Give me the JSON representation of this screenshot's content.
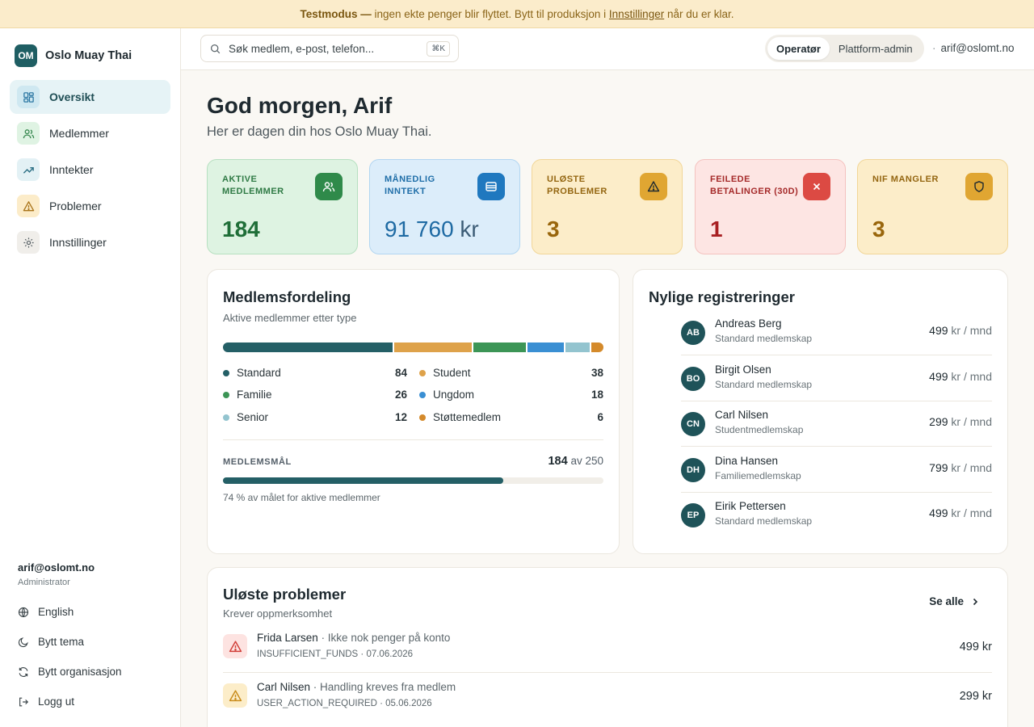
{
  "banner": {
    "strong": "Testmodus —",
    "text": "ingen ekte penger blir flyttet. Bytt til produksjon i",
    "link": "Innstillinger",
    "tail": "når du er klar."
  },
  "brand": {
    "initials": "OM",
    "name": "Oslo Muay Thai"
  },
  "nav": [
    {
      "label": "Oversikt",
      "icon": "dashboard-icon",
      "active": true
    },
    {
      "label": "Medlemmer",
      "icon": "users-icon"
    },
    {
      "label": "Inntekter",
      "icon": "trending-up-icon"
    },
    {
      "label": "Problemer",
      "icon": "warning-icon"
    },
    {
      "label": "Innstillinger",
      "icon": "gear-icon"
    }
  ],
  "sidebar_user": {
    "email": "arif@oslomt.no",
    "role": "Administrator"
  },
  "sidebar_links": [
    {
      "label": "English",
      "icon": "globe-icon"
    },
    {
      "label": "Bytt tema",
      "icon": "moon-icon"
    },
    {
      "label": "Bytt organisasjon",
      "icon": "refresh-icon"
    },
    {
      "label": "Logg ut",
      "icon": "logout-icon"
    }
  ],
  "topbar": {
    "search_placeholder": "Søk medlem, e-post, telefon...",
    "shortcut": "⌘K",
    "modes": [
      "Operatør",
      "Plattform-admin"
    ],
    "active_mode": "Operatør",
    "user": "arif@oslomt.no"
  },
  "greeting": {
    "title": "God morgen, Arif",
    "subtitle": "Her er dagen din hos Oslo Muay Thai."
  },
  "stats": [
    {
      "label": "Aktive medlemmer",
      "value": "184",
      "unit": "",
      "icon": "users-icon"
    },
    {
      "label": "Månedlig inntekt",
      "value": "91 760",
      "unit": "kr",
      "icon": "card-icon"
    },
    {
      "label": "Uløste problemer",
      "value": "3",
      "unit": "",
      "icon": "warning-icon"
    },
    {
      "label": "Feilede betalinger (30d)",
      "value": "1",
      "unit": "",
      "icon": "close-icon"
    },
    {
      "label": "NIF mangler",
      "value": "3",
      "unit": "",
      "icon": "shield-icon"
    }
  ],
  "distribution": {
    "title": "Medlemsfordeling",
    "subtitle": "Aktive medlemmer etter type",
    "segments": [
      {
        "name": "Standard",
        "count": 84,
        "color": "#245f66"
      },
      {
        "name": "Student",
        "count": 38,
        "color": "#dea24a"
      },
      {
        "name": "Familie",
        "count": 26,
        "color": "#3c9556"
      },
      {
        "name": "Ungdom",
        "count": 18,
        "color": "#3a8fd3"
      },
      {
        "name": "Senior",
        "count": 12,
        "color": "#93c4cf"
      },
      {
        "name": "Støttemedlem",
        "count": 6,
        "color": "#d48a2b"
      }
    ],
    "goal_label": "Medlemsmål",
    "goal_current": "184",
    "goal_target_text": "av 250",
    "goal_fraction": 0.736,
    "goal_note": "74 % av målet for aktive medlemmer"
  },
  "registrations": {
    "title": "Nylige registreringer",
    "rows": [
      {
        "initials": "AB",
        "name": "Andreas Berg",
        "plan": "Standard medlemskap",
        "price": "499",
        "unit": "kr / mnd"
      },
      {
        "initials": "BO",
        "name": "Birgit Olsen",
        "plan": "Standard medlemskap",
        "price": "499",
        "unit": "kr / mnd"
      },
      {
        "initials": "CN",
        "name": "Carl Nilsen",
        "plan": "Studentmedlemskap",
        "price": "299",
        "unit": "kr / mnd"
      },
      {
        "initials": "DH",
        "name": "Dina Hansen",
        "plan": "Familiemedlemskap",
        "price": "799",
        "unit": "kr / mnd"
      },
      {
        "initials": "EP",
        "name": "Eirik Pettersen",
        "plan": "Standard medlemskap",
        "price": "499",
        "unit": "kr / mnd"
      }
    ]
  },
  "problems": {
    "title": "Uløste problemer",
    "subtitle": "Krever oppmerksomhet",
    "see_all": "Se alle",
    "rows": [
      {
        "name": "Frida Larsen",
        "issue": "· Ikke nok penger på konto",
        "code": "INSUFFICIENT_FUNDS · 07.06.2026",
        "amount": "499 kr",
        "severity": "error"
      },
      {
        "name": "Carl Nilsen",
        "issue": "· Handling kreves fra medlem",
        "code": "USER_ACTION_REQUIRED · 05.06.2026",
        "amount": "299 kr",
        "severity": "warning"
      }
    ]
  },
  "colors": {
    "accent": "#1f5e63",
    "green": "#2f8a4a",
    "blue": "#1f6fa8",
    "amber": "#9a6a10",
    "red": "#b3262a"
  }
}
